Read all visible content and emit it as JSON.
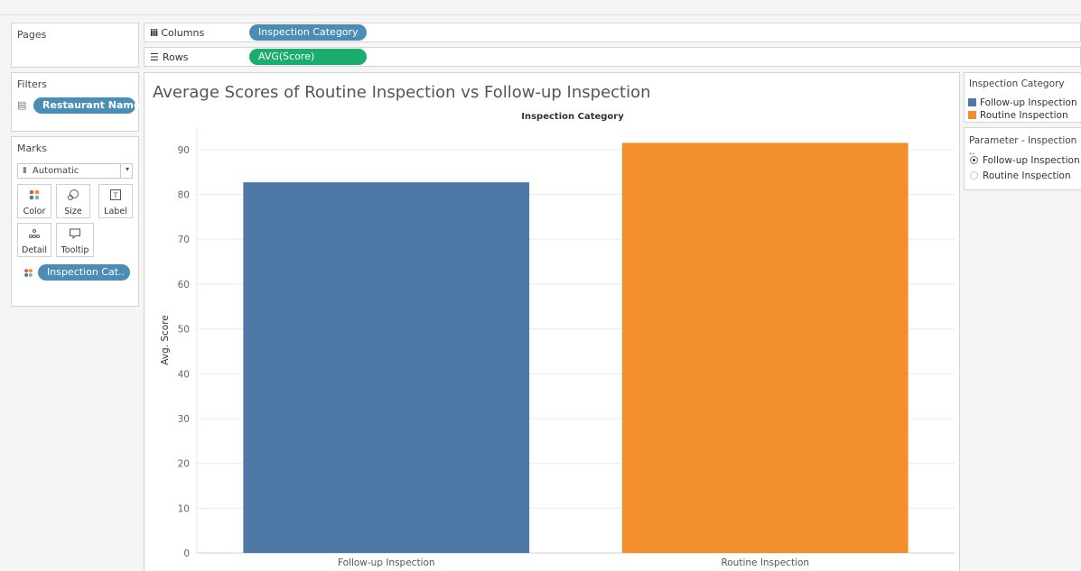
{
  "pages": {
    "title": "Pages"
  },
  "columns": {
    "label": "Columns",
    "pill": "Inspection Category"
  },
  "rows": {
    "label": "Rows",
    "pill": "AVG(Score)"
  },
  "filters": {
    "title": "Filters",
    "pill": "Restaurant Name"
  },
  "marks": {
    "title": "Marks",
    "type": "Automatic",
    "buttons": [
      "Color",
      "Size",
      "Label",
      "Detail",
      "Tooltip"
    ],
    "field": "Inspection Cat.."
  },
  "legend": {
    "title": "Inspection Category",
    "items": [
      {
        "label": "Follow-up Inspection",
        "color": "#4e79a7"
      },
      {
        "label": "Routine Inspection",
        "color": "#f28e2b"
      }
    ]
  },
  "parameter": {
    "title": "Parameter - Inspection ..",
    "options": [
      {
        "label": "Follow-up Inspection",
        "selected": true
      },
      {
        "label": "Routine Inspection",
        "selected": false
      }
    ]
  },
  "chart_data": {
    "type": "bar",
    "title": "Average Scores of Routine Inspection vs Follow-up Inspection",
    "header": "Inspection Category",
    "ylabel": "Avg. Score",
    "categories": [
      "Follow-up Inspection",
      "Routine Inspection"
    ],
    "values": [
      82.7,
      91.5
    ],
    "colors": [
      "#4e79a7",
      "#f28e2b"
    ],
    "ylim": [
      0,
      95
    ],
    "yticks": [
      0,
      10,
      20,
      30,
      40,
      50,
      60,
      70,
      80,
      90
    ],
    "grid": true,
    "legend_position": "right"
  }
}
